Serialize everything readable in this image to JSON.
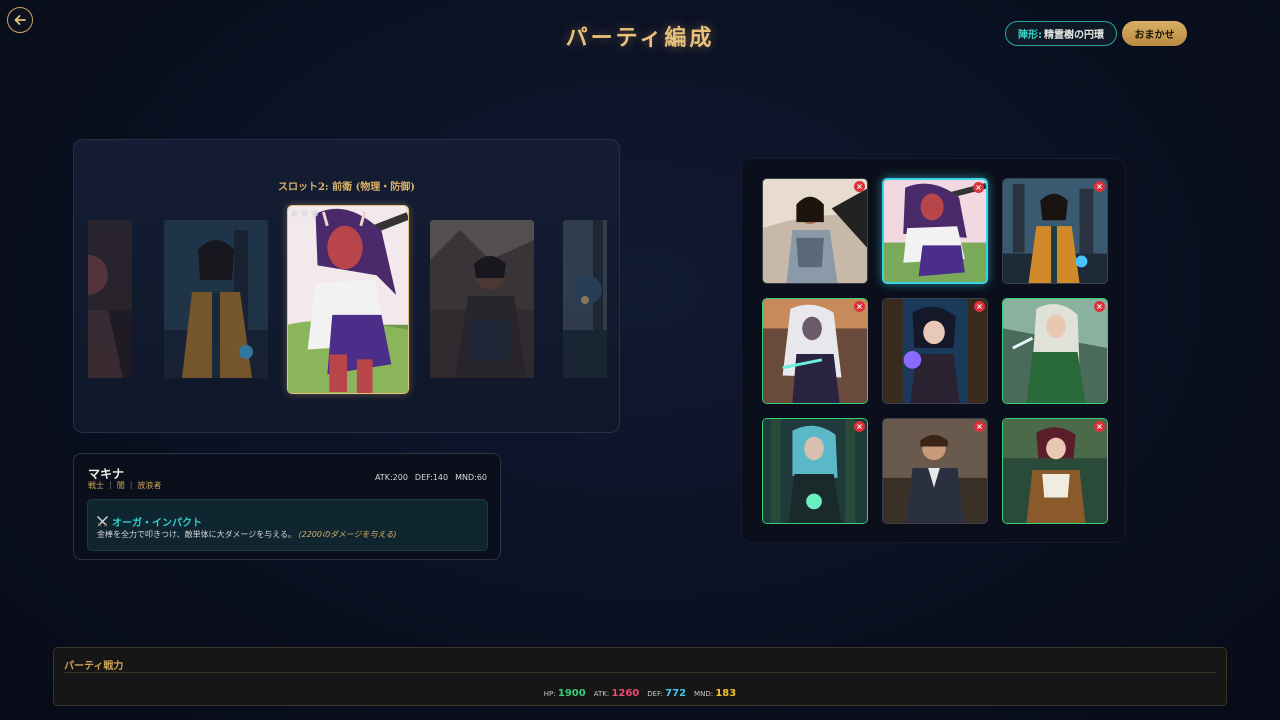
{
  "header": {
    "title": "パーティ編成",
    "back_icon": "arrow-left-icon",
    "formation_label": "陣形:",
    "formation_value": "精霊樹の円環",
    "auto_button": "おまかせ"
  },
  "carousel": {
    "slot_title": "スロット2: 前衛 (物理・防御)"
  },
  "character": {
    "name": "マキナ",
    "tags": [
      "戦士",
      "闇",
      "放浪者"
    ],
    "stats": {
      "atk": "ATK:200",
      "def": "DEF:140",
      "mnd": "MND:60"
    },
    "skill": {
      "icon": "crossed-swords-icon",
      "name": "オーガ・インパクト",
      "description": "金棒を全力で叩きつけ、敵単体に大ダメージを与える。",
      "note": "(2200のダメージを与える)"
    }
  },
  "party_power": {
    "title": "パーティ戦力",
    "hp_label": "HP:",
    "hp_value": "1900",
    "atk_label": "ATK:",
    "atk_value": "1260",
    "def_label": "DEF:",
    "def_value": "772",
    "mnd_label": "MND:",
    "mnd_value": "183",
    "colors": {
      "hp": "#35d07a",
      "atk": "#f0476f",
      "def": "#3ec6ee",
      "mnd": "#f2c230"
    }
  },
  "colors": {
    "accent_gold": "#e8c27a",
    "accent_teal": "#3ed1c6",
    "selected_border": "#38d4e8",
    "set_border": "#36d07a",
    "remove": "#d9323a"
  }
}
